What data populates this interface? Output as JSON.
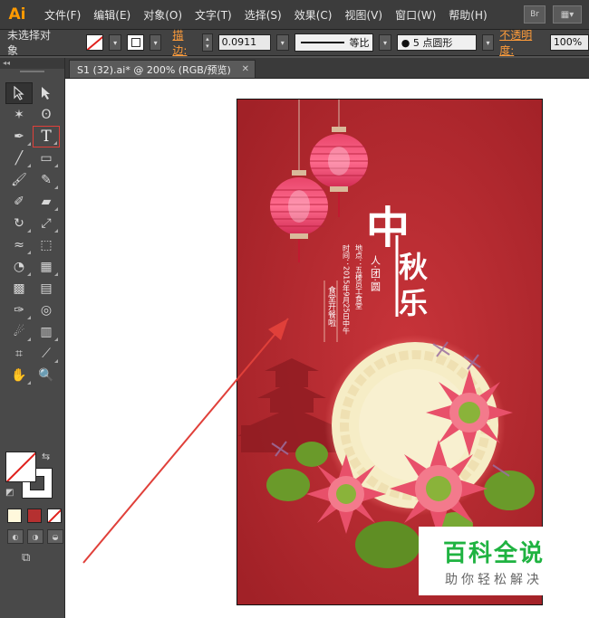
{
  "app": {
    "logo": "Ai"
  },
  "menu": {
    "items": [
      "文件(F)",
      "编辑(E)",
      "对象(O)",
      "文字(T)",
      "选择(S)",
      "效果(C)",
      "视图(V)",
      "窗口(W)",
      "帮助(H)"
    ],
    "bridge_label": "Br"
  },
  "control_bar": {
    "selection_status": "未选择对象",
    "stroke_label": "描边:",
    "stroke_weight": "0.0911",
    "stroke_profile": "等比",
    "brush": "5 点圆形",
    "opacity_label": "不透明度:",
    "opacity_value": "100%"
  },
  "toolbox": {
    "collapse_label": "◂◂"
  },
  "document_tab": {
    "title": "S1 (32).ai* @ 200% (RGB/预览)",
    "close": "✕"
  },
  "artwork": {
    "title_chars": [
      "中",
      "秋",
      "乐"
    ],
    "subtitle": "人·团·圆",
    "detail_line1": "地点：五楼员工食堂",
    "detail_line2": "时间：2015年9月25日中午",
    "vertical_banner": "食堂开餐啦",
    "colors": {
      "background": "#b8282c",
      "moon": "#f6edc6",
      "lotus": "#e8506a",
      "leaf": "#6a9a2a"
    }
  },
  "watermark": {
    "title": "百科全说",
    "subtitle": "助你轻松解决"
  },
  "annotation": {
    "arrow_color": "#e0403a"
  }
}
